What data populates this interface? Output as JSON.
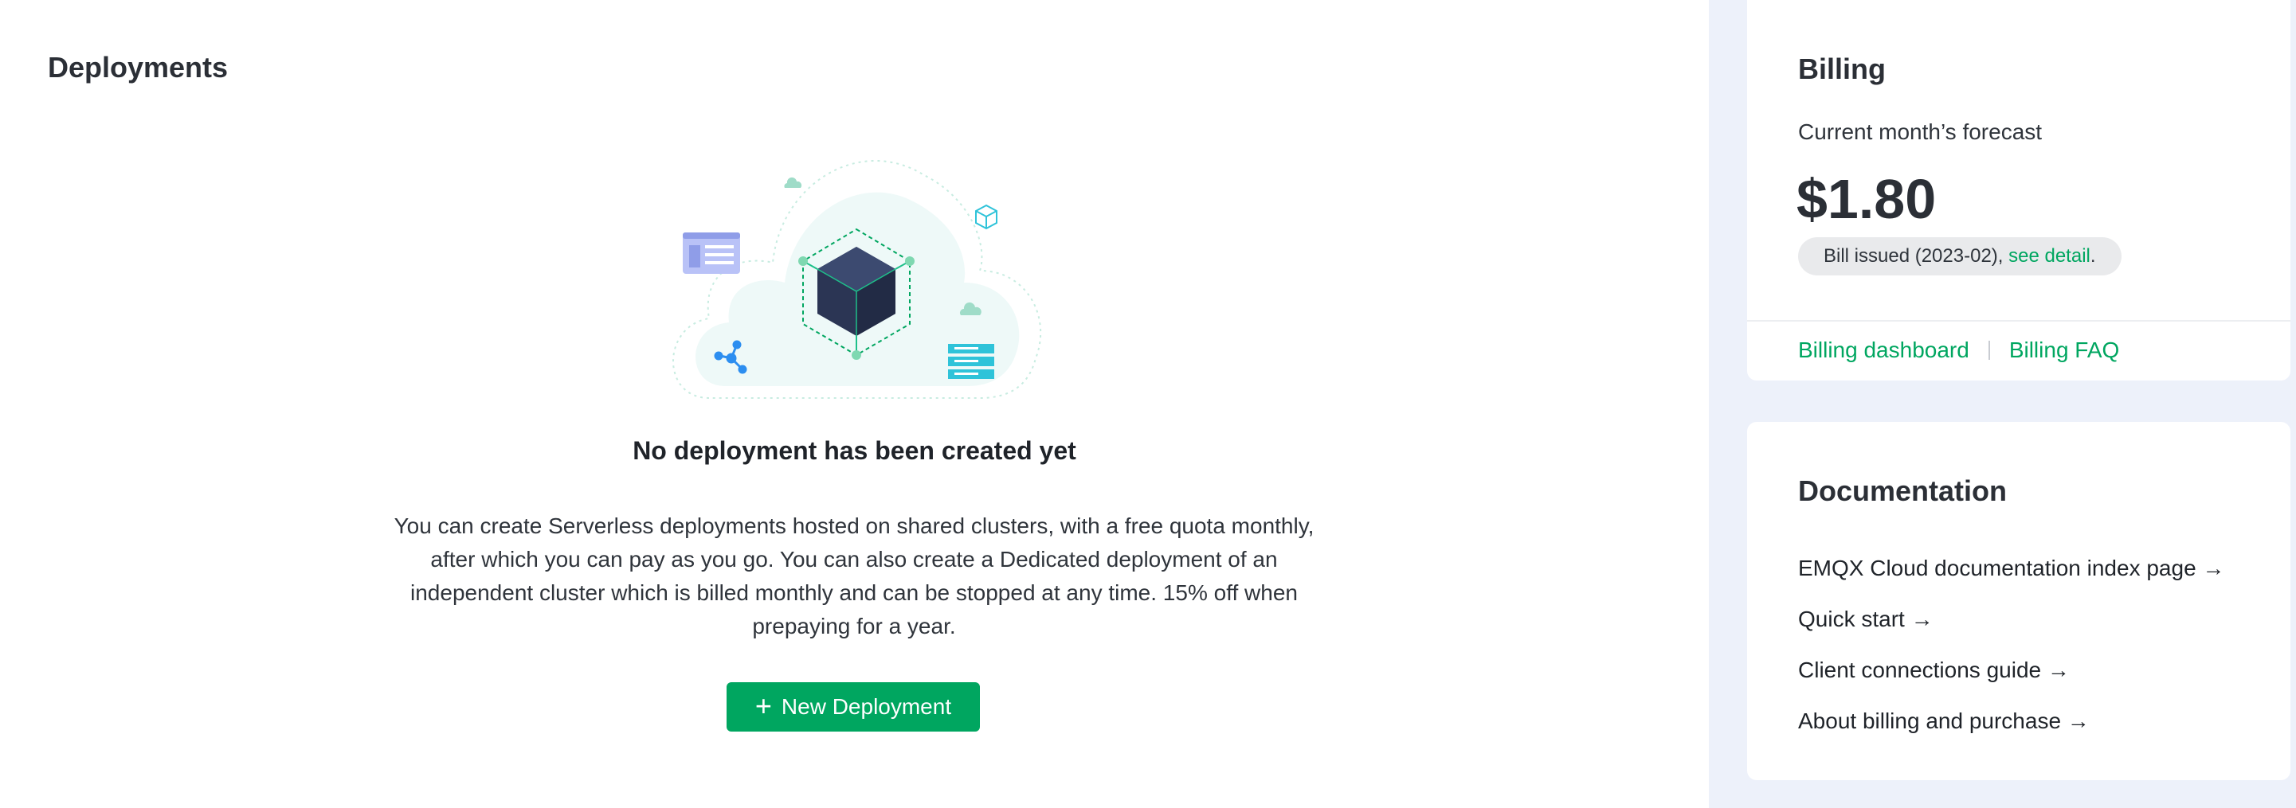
{
  "main": {
    "title": "Deployments",
    "empty_state": {
      "title": "No deployment has been created yet",
      "description": "You can create Serverless deployments hosted on shared clusters, with a free quota monthly, after which you can pay as you go. You can also create a Dedicated deployment of an independent cluster which is billed monthly and can be stopped at any time. 15% off when prepaying for a year.",
      "button_label": "New Deployment",
      "button_icon": "plus-icon"
    }
  },
  "billing": {
    "title": "Billing",
    "forecast_label": "Current month’s forecast",
    "amount": "$1.80",
    "bill_issued": "Bill issued (2023-02), ",
    "see_detail": "see detail",
    "period": ".",
    "links": {
      "dashboard": "Billing dashboard",
      "faq": "Billing FAQ"
    }
  },
  "documentation": {
    "title": "Documentation",
    "links": [
      {
        "label": "EMQX Cloud documentation index page →"
      },
      {
        "label": "Quick start →"
      },
      {
        "label": "Client connections guide →"
      },
      {
        "label": "About billing and purchase →"
      }
    ]
  },
  "colors": {
    "accent": "#00a660",
    "sidebar_bg": "#edf1fa"
  }
}
